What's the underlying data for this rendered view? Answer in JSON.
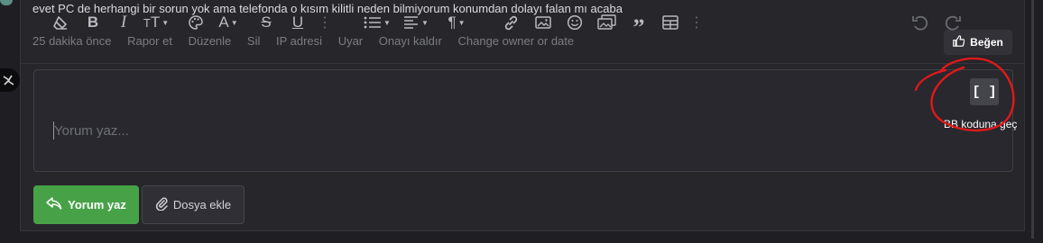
{
  "post": {
    "text": "evet PC de herhangi bir sorun yok ama telefonda o kısım kilitli neden bilmiyorum konumdan dolayı falan mı acaba",
    "time": "25 dakika önce",
    "actions": [
      "Rapor et",
      "Düzenle",
      "Sil",
      "IP adresi",
      "Uyar",
      "Onayı kaldır",
      "Change owner or date"
    ],
    "like_label": "Beğen"
  },
  "editor": {
    "placeholder": "Yorum yaz...",
    "tooltip": "BB koduna geç",
    "bb_code_label": "[ ]",
    "toolbar_icons": [
      "eraser-icon",
      "bold-icon",
      "italic-icon",
      "font-size-icon",
      "palette-icon",
      "text-color-icon",
      "strikethrough-icon",
      "underline-icon",
      "list-icon",
      "align-icon",
      "paragraph-icon",
      "link-icon",
      "image-icon",
      "smiley-icon",
      "media-icon",
      "quote-icon",
      "table-icon",
      "undo-icon",
      "redo-icon",
      "bb-code-icon"
    ],
    "annotation_color": "#e11919"
  },
  "buttons": {
    "post_label": "Yorum yaz",
    "attach_label": "Dosya ekle",
    "post_color": "#47a247"
  }
}
